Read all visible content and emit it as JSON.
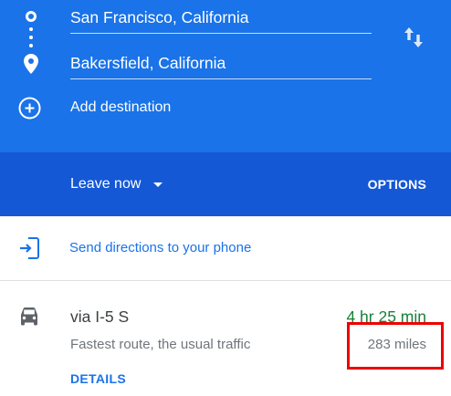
{
  "directions": {
    "origin": "San Francisco, California",
    "destination": "Bakersfield, California",
    "add_destination": "Add destination"
  },
  "departure": {
    "leave_now": "Leave now",
    "options": "OPTIONS"
  },
  "send": {
    "label": "Send directions to your phone"
  },
  "route": {
    "via": "via I-5 S",
    "duration": "4 hr 25 min",
    "description": "Fastest route, the usual traffic",
    "distance": "283 miles",
    "details": "DETAILS"
  },
  "colors": {
    "header_blue": "#1a73e8",
    "leave_bar_blue": "#1558d6",
    "duration_green": "#188038",
    "highlight_red": "#ee0000"
  },
  "icons": [
    "origin-circle-icon",
    "route-dots-icon",
    "destination-pin-icon",
    "swap-arrows-icon",
    "add-circle-icon",
    "chevron-down-icon",
    "send-to-phone-icon",
    "car-icon"
  ]
}
